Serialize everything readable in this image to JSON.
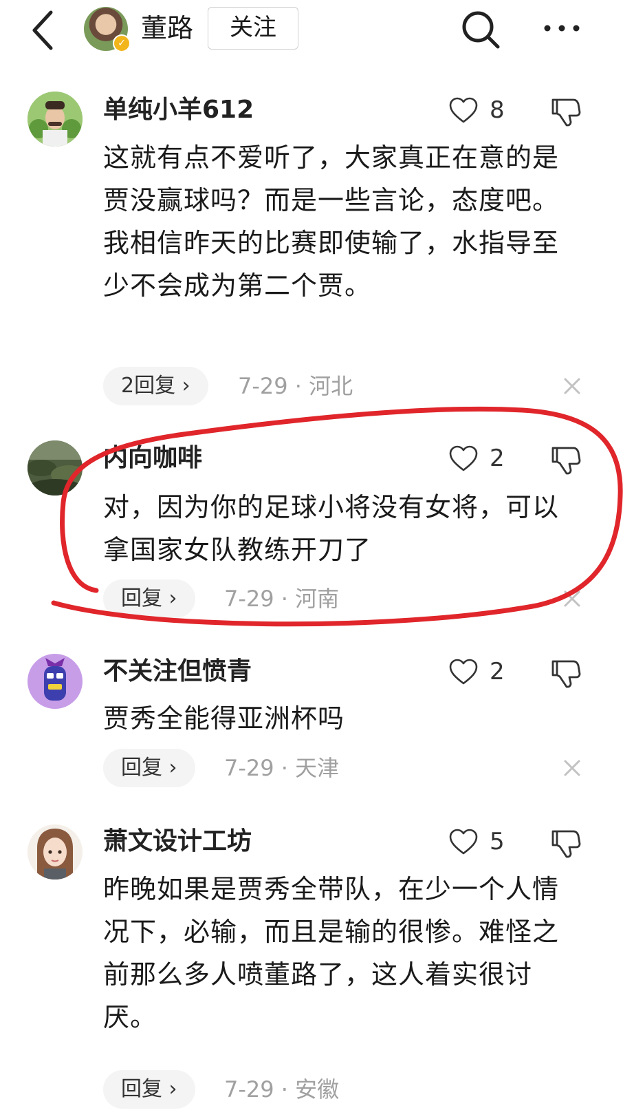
{
  "header": {
    "author_name": "董路",
    "follow_label": "关注"
  },
  "comments": [
    {
      "username": "单纯小羊612",
      "likes": "8",
      "text": "这就有点不爱听了，大家真正在意的是贾没赢球吗？而是一些言论，态度吧。我相信昨天的比赛即使输了，水指导至少不会成为第二个贾。",
      "reply_label": "2回复 ›",
      "meta": "7-29 · 河北"
    },
    {
      "username": "内向咖啡",
      "likes": "2",
      "text": "对，因为你的足球小将没有女将，可以拿国家女队教练开刀了",
      "reply_label": "回复 ›",
      "meta": "7-29 · 河南"
    },
    {
      "username": "不关注但愤青",
      "likes": "2",
      "text": "贾秀全能得亚洲杯吗",
      "reply_label": "回复 ›",
      "meta": "7-29 · 天津"
    },
    {
      "username": "萧文设计工坊",
      "likes": "5",
      "text": "昨晚如果是贾秀全带队，在少一个人情况下，必输，而且是输的很惨。难怪之前那么多人喷董路了，这人着实很讨厌。",
      "reply_label": "回复 ›",
      "meta": "7-29 · 安徽"
    }
  ],
  "colors": {
    "annotation_red": "#e0262b",
    "verified_gold": "#f2b61c",
    "meta_gray": "#a0a0a0"
  }
}
